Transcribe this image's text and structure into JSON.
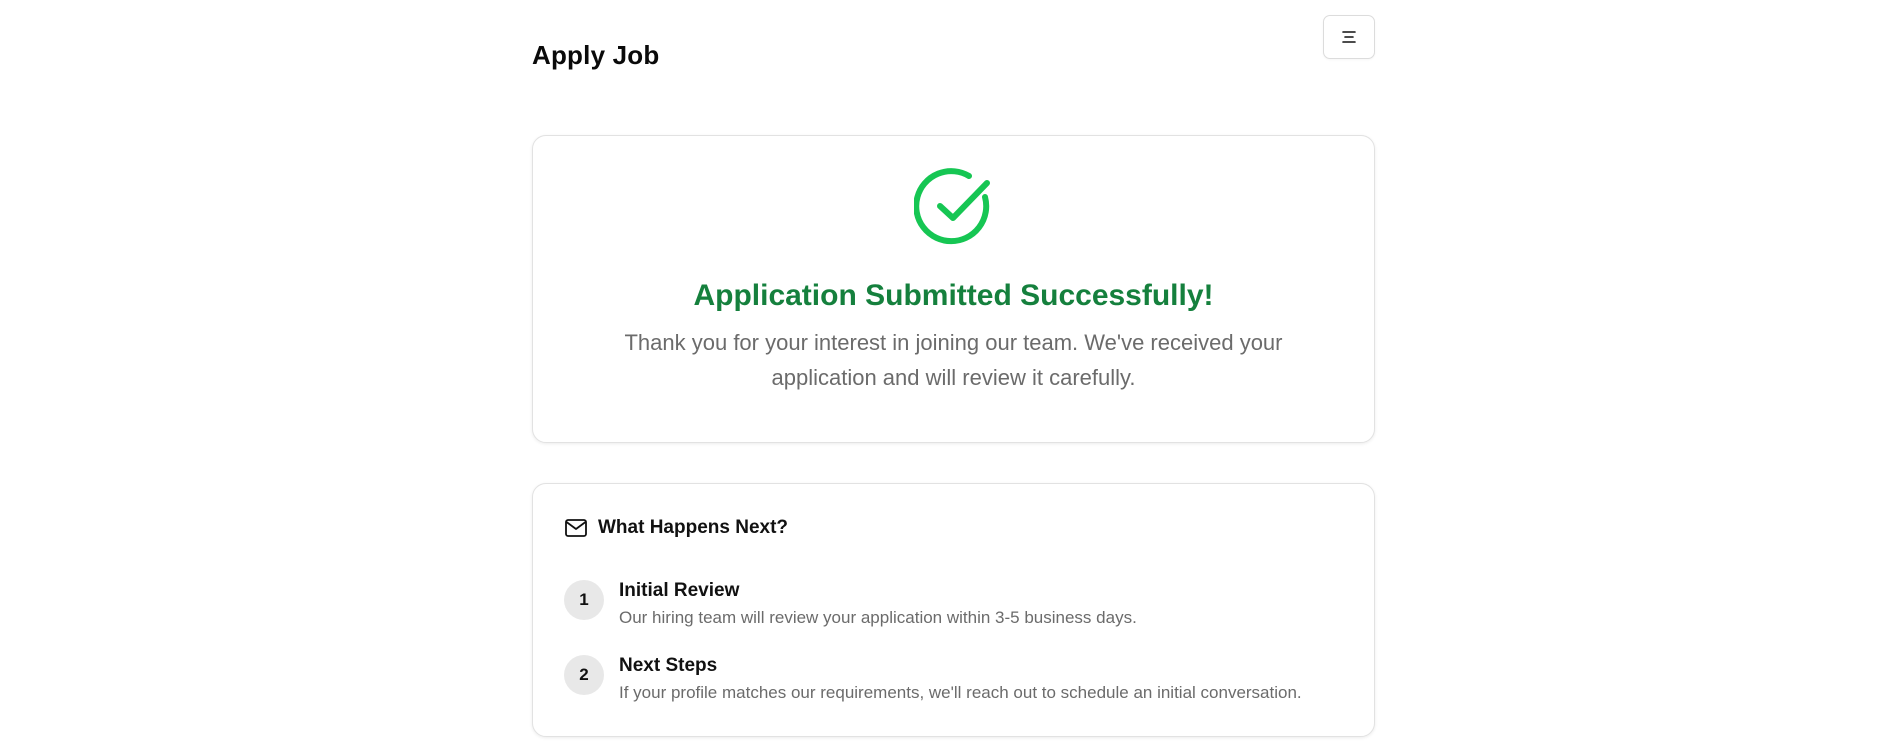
{
  "header": {
    "title": "Apply Job",
    "menu_icon": "menu-icon"
  },
  "success": {
    "icon": "check-circle-icon",
    "title": "Application Submitted Successfully!",
    "message": "Thank you for your interest in joining our team. We've received your application and will review it carefully.",
    "accent_color": "#15803d",
    "icon_color": "#16c653"
  },
  "next": {
    "icon": "mail-icon",
    "title": "What Happens Next?",
    "steps": [
      {
        "number": "1",
        "title": "Initial Review",
        "description": "Our hiring team will review your application within 3-5 business days."
      },
      {
        "number": "2",
        "title": "Next Steps",
        "description": "If your profile matches our requirements, we'll reach out to schedule an initial conversation."
      }
    ]
  }
}
